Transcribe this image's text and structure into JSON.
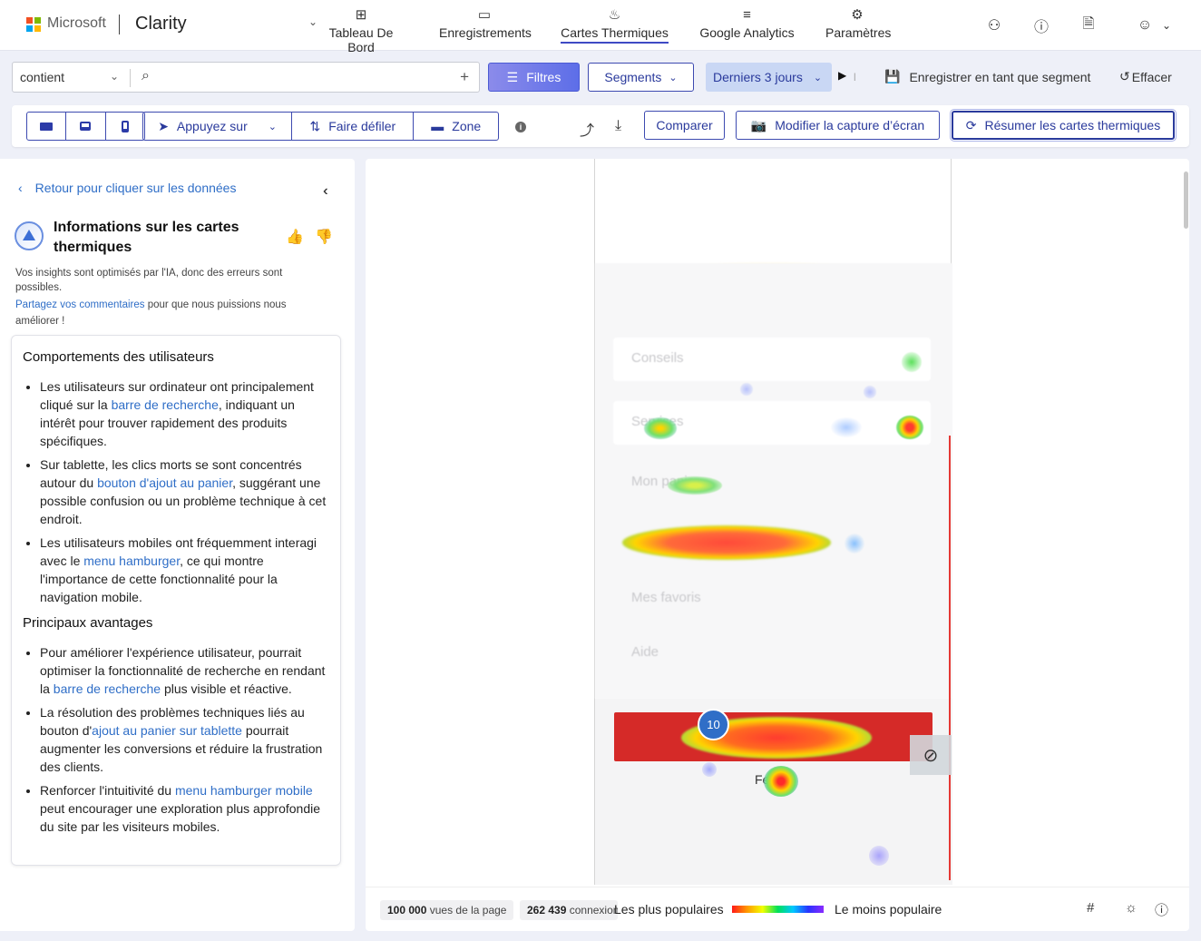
{
  "brand": {
    "company": "Microsoft",
    "app": "Clarity"
  },
  "nav": {
    "items": [
      {
        "label": "Tableau De Bord",
        "icon": "dashboard-icon"
      },
      {
        "label": "Enregistrements",
        "icon": "video-icon"
      },
      {
        "label": "Cartes Thermiques",
        "icon": "flame-icon",
        "active": true
      },
      {
        "label": "Google Analytics",
        "icon": "analytics-icon"
      },
      {
        "label": "Paramètres",
        "icon": "gear-icon"
      }
    ],
    "right_icons": [
      "people-share-icon",
      "help-icon",
      "document-icon",
      "account-icon"
    ]
  },
  "filter_row": {
    "operator": "contient",
    "search_value": "",
    "filters_label": "Filtres",
    "segments_label": "Segments",
    "range_label": "Derniers 3 jours",
    "save_segment_label": "Enregistrer en tant que segment",
    "reset_label": "Effacer"
  },
  "toolbar": {
    "modes": [
      "Appuyez sur",
      "Faire défiler",
      "Zone"
    ],
    "compare_label": "Comparer",
    "screenshot_label": "Modifier la capture d’écran",
    "summarize_label": "Résumer les cartes thermiques"
  },
  "insights": {
    "back_label": "Retour pour cliquer sur les données",
    "title": "Informations sur les cartes thermiques",
    "disclaimer": "Vos insights sont optimisés par l'IA, donc des erreurs sont possibles.",
    "feedback_link": "Partagez vos commentaires",
    "feedback_rest": " pour que nous puissions nous améliorer !",
    "section1_title": "Comportements des utilisateurs",
    "b1": {
      "a": "Les utilisateurs sur ordinateur ont principalement cliqué sur la ",
      "link": "barre de recherche",
      "b": ", indiquant un intérêt pour trouver rapidement des produits spécifiques."
    },
    "b2": {
      "a": "Sur tablette, les clics morts se sont concentrés autour du ",
      "link": "bouton d'ajout au panier",
      "b": ", suggérant une possible confusion ou un problème technique à cet endroit."
    },
    "b3": {
      "a": "Les utilisateurs mobiles ont fréquemment interagi avec le ",
      "link": "menu hamburger",
      "b": ", ce qui montre l'importance de cette fonctionnalité pour la navigation mobile."
    },
    "section2_title": "Principaux avantages",
    "b4": {
      "a": "Pour améliorer l'expérience utilisateur, pourrait optimiser la fonctionnalité de recherche en rendant la ",
      "link": "barre de recherche",
      "b": " plus visible et réactive."
    },
    "b5": {
      "a": "La résolution des problèmes techniques liés au bouton d'",
      "link": "ajout au panier sur tablette",
      "b": " pourrait augmenter les conversions et réduire la frustration des clients."
    },
    "b6": {
      "a": "Renforcer l'intuitivité du ",
      "link": "menu hamburger mobile",
      "b": " peut encourager une exploration plus approfondie du site par les visiteurs mobiles."
    }
  },
  "heatmap": {
    "rows": [
      "Conseils",
      "Services",
      "Mon panier",
      "",
      "Mes favoris",
      "Aide"
    ],
    "badge_count": "10",
    "button_text": "Fer"
  },
  "footer": {
    "page_views_value": "100 000",
    "page_views_label": "vues de la page",
    "clicks_value": "262 439",
    "clicks_label": "connexions",
    "legend_most": "Les plus populaires",
    "legend_least": "Le moins populaire"
  },
  "colors": {
    "accent": "#3d4ab0",
    "link": "#2f6ec7",
    "filters_bg": "#6f7ce9",
    "range_bg": "#c9d7f4"
  }
}
